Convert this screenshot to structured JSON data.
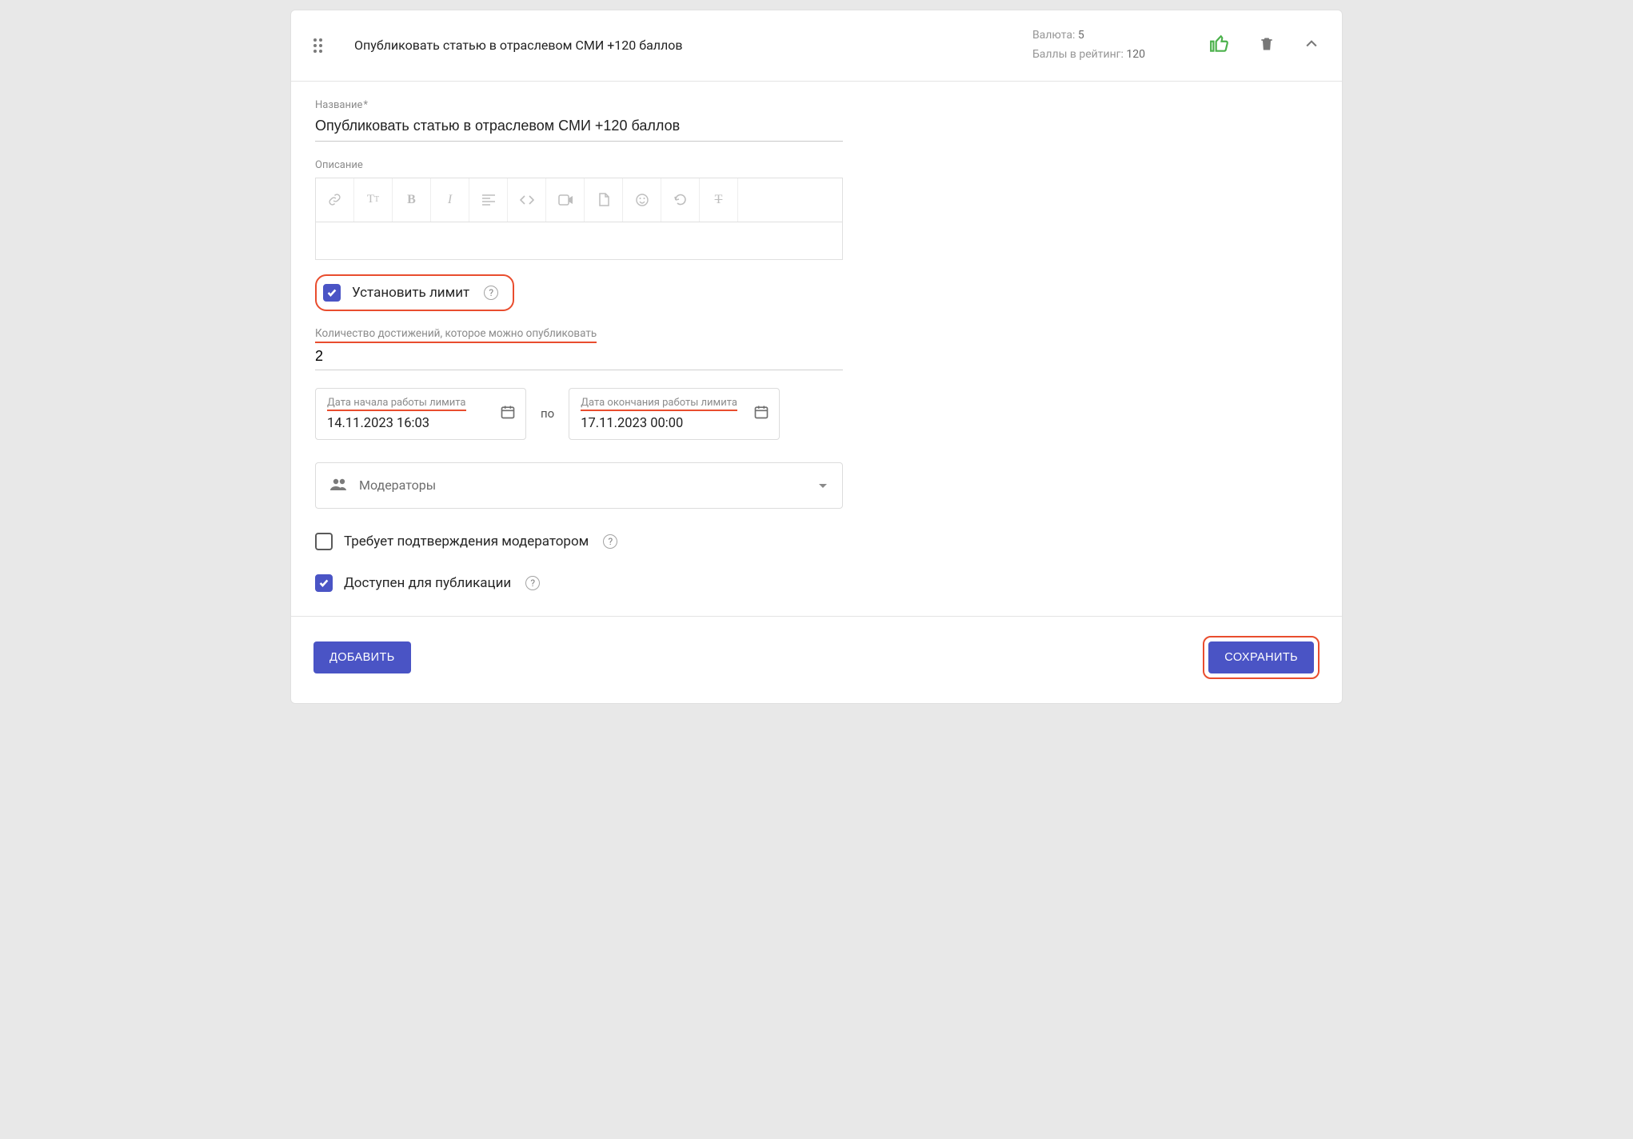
{
  "header": {
    "title": "Опубликовать статью в отраслевом СМИ +120 баллов",
    "currency_label": "Валюта:",
    "currency_value": "5",
    "points_label": "Баллы в рейтинг:",
    "points_value": "120"
  },
  "form": {
    "name_label": "Название",
    "name_required_mark": "*",
    "name_value": "Опубликовать статью в отраслевом СМИ +120 баллов",
    "description_label": "Описание",
    "limit_checkbox_label": "Установить лимит",
    "limit_count_label": "Количество достижений, которое можно опубликовать",
    "limit_count_value": "2",
    "date_start_label": "Дата начала работы лимита",
    "date_start_value": "14.11.2023 16:03",
    "date_sep": "по",
    "date_end_label": "Дата окончания работы лимита",
    "date_end_value": "17.11.2023 00:00",
    "moderators_label": "Модераторы",
    "requires_confirm_label": "Требует подтверждения модератором",
    "published_label": "Доступен для публикации"
  },
  "footer": {
    "add_label": "ДОБАВИТЬ",
    "save_label": "СОХРАНИТЬ"
  },
  "editor_icons": [
    "link",
    "text-size",
    "bold",
    "italic",
    "align",
    "code",
    "video",
    "file",
    "emoji",
    "undo",
    "strikethrough"
  ]
}
